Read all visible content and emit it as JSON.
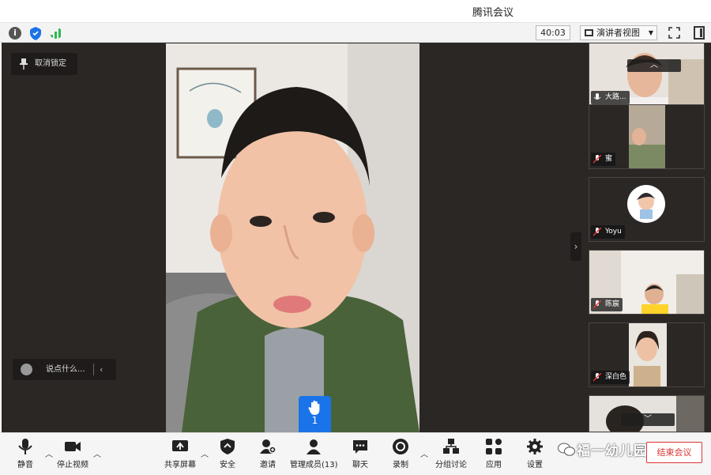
{
  "window": {
    "title": "腾讯会议"
  },
  "infobar": {
    "timer": "40:03",
    "view_mode": "演讲者视图"
  },
  "stage": {
    "unpin_label": "取消锁定",
    "chat_placeholder": "说点什么...",
    "raised_hands_count": "1"
  },
  "participants": [
    {
      "name": "大路..."
    },
    {
      "name": "蜜"
    },
    {
      "name": "Yoyu"
    },
    {
      "name": "陈宸"
    },
    {
      "name": "深白色"
    }
  ],
  "toolbar": {
    "mute": "静音",
    "stop_video": "停止视频",
    "share_screen": "共享屏幕",
    "security": "安全",
    "invite": "邀请",
    "manage_members": "管理成员(13)",
    "chat": "聊天",
    "record": "录制",
    "breakout": "分组讨论",
    "apps": "应用",
    "settings": "设置",
    "end_meeting": "结束会议"
  },
  "watermark": "福一幼儿园",
  "colors": {
    "accent": "#1a73e8",
    "end": "#d33333",
    "stage_bg": "#2b2725"
  }
}
